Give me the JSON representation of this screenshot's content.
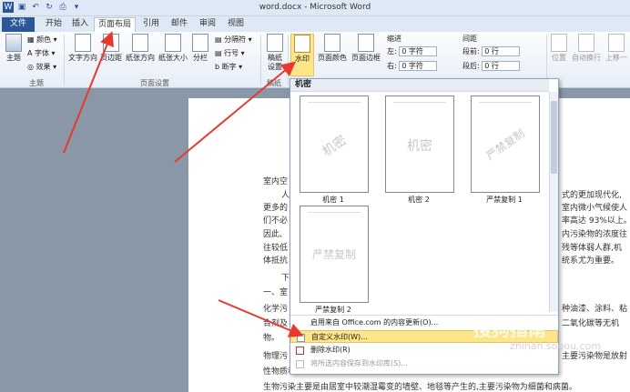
{
  "window": {
    "title": "word.docx - Microsoft Word"
  },
  "qat": {
    "icons": [
      "word-logo-icon",
      "save-icon",
      "undo-icon",
      "redo-icon",
      "quick-print-icon",
      "customize-icon"
    ]
  },
  "tabs": [
    {
      "label": "文件"
    },
    {
      "label": "开始"
    },
    {
      "label": "插入"
    },
    {
      "label": "页面布局"
    },
    {
      "label": "引用"
    },
    {
      "label": "邮件"
    },
    {
      "label": "审阅"
    },
    {
      "label": "视图"
    }
  ],
  "ribbon": {
    "theme": {
      "btn": "主题",
      "colors": "颜色",
      "fonts": "字体",
      "effects": "效果",
      "label": "主题"
    },
    "page_setup": {
      "text_dir": "文字方向",
      "margins": "页边距",
      "orientation": "纸张方向",
      "size": "纸张大小",
      "columns": "分栏",
      "breaks": "分隔符",
      "line_numbers": "行号",
      "hyphenation": "断字",
      "label": "页面设置"
    },
    "draft": {
      "btn1": "稿纸",
      "btn2": "设置",
      "label": "稿纸"
    },
    "bg": {
      "watermark": "水印",
      "page_color": "页面颜色",
      "borders": "页面边框"
    },
    "indent": {
      "title": "缩进",
      "left": "左:",
      "right": "右:",
      "left_val": "0 字符",
      "right_val": "0 字符"
    },
    "spacing": {
      "title": "间距",
      "before": "段前:",
      "after": "段后:",
      "before_val": "0 行",
      "after_val": "0 行"
    },
    "arrange": {
      "position": "位置",
      "wrap": "自动换行",
      "forward": "上移一"
    }
  },
  "gallery": {
    "header": "机密",
    "items": [
      {
        "wm": "机密",
        "cap": "机密 1"
      },
      {
        "wm": "机密",
        "cap": "机密 2"
      },
      {
        "wm": "严禁复制",
        "cap": "严禁复制 1"
      },
      {
        "wm": "严禁复制",
        "cap": "严禁复制 2"
      }
    ],
    "menu": [
      "启用来自 Office.com 的内容更新(O)...",
      "自定义水印(W)...",
      "删除水印(R)",
      "将所选内容保存到水印库(S)..."
    ]
  },
  "document": {
    "lines": [
      "室内空",
      "人",
      "更多的",
      "们不必",
      "因此,",
      "往较低",
      "体抵抗",
      "下",
      "一、室",
      "化学污",
      "合剂及",
      "物。",
      "物理污",
      "性物质和电磁辐射。",
      "生物污染主要是由居室中较潮湿霉变的墙壁、地毯等产生的,主要污染物为细菌和病菌。"
    ],
    "right_frags": [
      "式的更加现代化,",
      "室内微小气候使人",
      "率高达 93%以上。",
      "内污染物的浓度往",
      "残等体弱人群,机",
      "统系尤为重要。",
      "种油漆、涂料、粘",
      "二氧化碳等无机",
      "主要污染物是放射"
    ]
  },
  "watermark_site": {
    "name": "搜狗指南",
    "url": "zhinan.sogou.com"
  }
}
